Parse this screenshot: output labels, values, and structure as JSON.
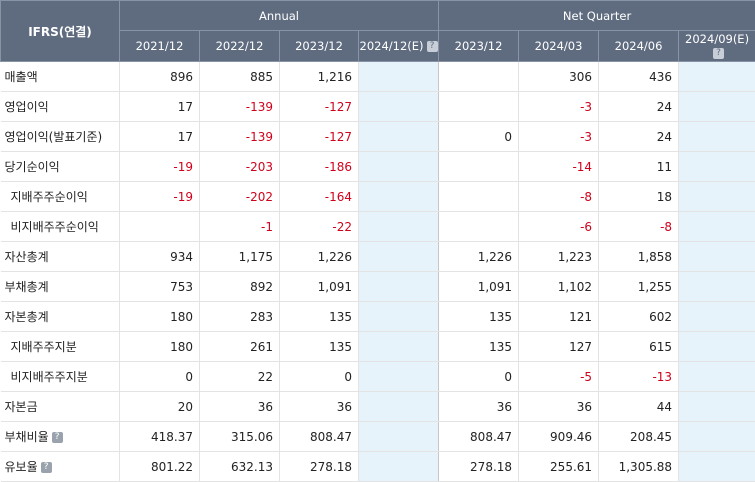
{
  "header": {
    "corner": "IFRS(연결)",
    "annual_label": "Annual",
    "quarter_label": "Net Quarter",
    "periods": [
      "2021/12",
      "2022/12",
      "2023/12",
      "2024/12(E)",
      "2023/12",
      "2024/03",
      "2024/06",
      "2024/09(E)"
    ]
  },
  "rows": [
    {
      "label": "매출액",
      "values": [
        "896",
        "885",
        "1,216",
        "",
        "",
        "306",
        "436",
        ""
      ]
    },
    {
      "label": "영업이익",
      "values": [
        "17",
        "-139",
        "-127",
        "",
        "",
        "-3",
        "24",
        ""
      ]
    },
    {
      "label": "영업이익(발표기준)",
      "values": [
        "17",
        "-139",
        "-127",
        "",
        "0",
        "-3",
        "24",
        ""
      ]
    },
    {
      "label": "당기순이익",
      "values": [
        "-19",
        "-203",
        "-186",
        "",
        "",
        "-14",
        "11",
        ""
      ]
    },
    {
      "label": "지배주주순이익",
      "values": [
        "-19",
        "-202",
        "-164",
        "",
        "",
        "-8",
        "18",
        ""
      ]
    },
    {
      "label": "비지배주주순이익",
      "values": [
        "",
        "-1",
        "-22",
        "",
        "",
        "-6",
        "-8",
        ""
      ]
    },
    {
      "label": "자산총계",
      "values": [
        "934",
        "1,175",
        "1,226",
        "",
        "1,226",
        "1,223",
        "1,858",
        ""
      ]
    },
    {
      "label": "부채총계",
      "values": [
        "753",
        "892",
        "1,091",
        "",
        "1,091",
        "1,102",
        "1,255",
        ""
      ]
    },
    {
      "label": "자본총계",
      "values": [
        "180",
        "283",
        "135",
        "",
        "135",
        "121",
        "602",
        ""
      ]
    },
    {
      "label": "지배주주지분",
      "values": [
        "180",
        "261",
        "135",
        "",
        "135",
        "127",
        "615",
        ""
      ]
    },
    {
      "label": "비지배주주지분",
      "values": [
        "0",
        "22",
        "0",
        "",
        "0",
        "-5",
        "-13",
        ""
      ]
    },
    {
      "label": "자본금",
      "values": [
        "20",
        "36",
        "36",
        "",
        "36",
        "36",
        "44",
        ""
      ]
    },
    {
      "label": "부채비율",
      "values": [
        "418.37",
        "315.06",
        "808.47",
        "",
        "808.47",
        "909.46",
        "208.45",
        ""
      ]
    },
    {
      "label": "유보율",
      "values": [
        "801.22",
        "632.13",
        "278.18",
        "",
        "278.18",
        "255.61",
        "1,305.88",
        ""
      ]
    }
  ]
}
